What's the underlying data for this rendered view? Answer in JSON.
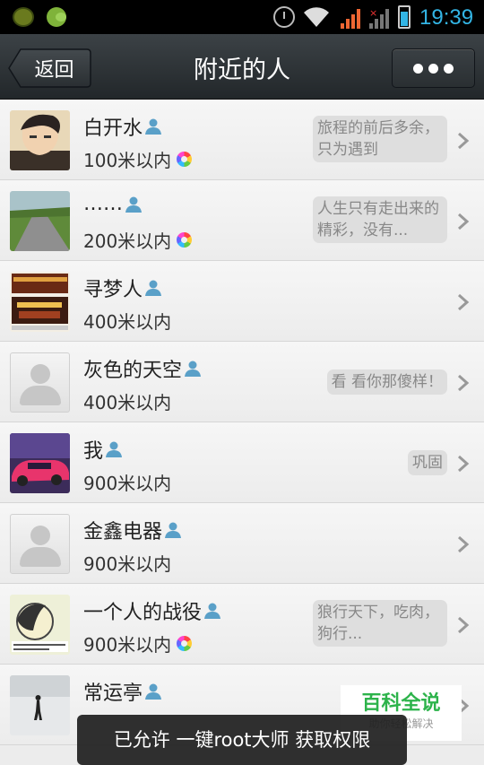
{
  "status_bar": {
    "time": "19:39"
  },
  "header": {
    "back_label": "返回",
    "title": "附近的人"
  },
  "people": [
    {
      "name": "白开水",
      "distance": "100米以内",
      "signature": "旅程的前后多余，只为遇到",
      "ring": true,
      "avatar": "photo-boy"
    },
    {
      "name": "……",
      "distance": "200米以内",
      "signature": "人生只有走出来的精彩，没有...",
      "ring": true,
      "avatar": "photo-road"
    },
    {
      "name": "寻梦人",
      "distance": "400米以内",
      "signature": "",
      "ring": false,
      "avatar": "photo-poster"
    },
    {
      "name": "灰色的天空",
      "distance": "400米以内",
      "signature": "看 看你那傻样！",
      "ring": false,
      "avatar": "default"
    },
    {
      "name": "我",
      "distance": "900米以内",
      "signature": "巩固",
      "ring": false,
      "avatar": "photo-car"
    },
    {
      "name": "金鑫电器",
      "distance": "900米以内",
      "signature": "",
      "ring": false,
      "avatar": "default"
    },
    {
      "name": "一个人的战役",
      "distance": "900米以内",
      "signature": "狼行天下，吃肉，狗行...",
      "ring": true,
      "avatar": "photo-cartoon"
    },
    {
      "name": "常运亭",
      "distance": "",
      "signature": "",
      "ring": false,
      "avatar": "photo-snow"
    }
  ],
  "toast": {
    "text": "已允许 一键root大师 获取权限"
  },
  "watermark": {
    "title": "百科全说",
    "subtitle": "助你轻松解决"
  },
  "colors": {
    "accent": "#33b5e5",
    "topbar": "#2b3033",
    "watermark_green": "#2db34b"
  }
}
